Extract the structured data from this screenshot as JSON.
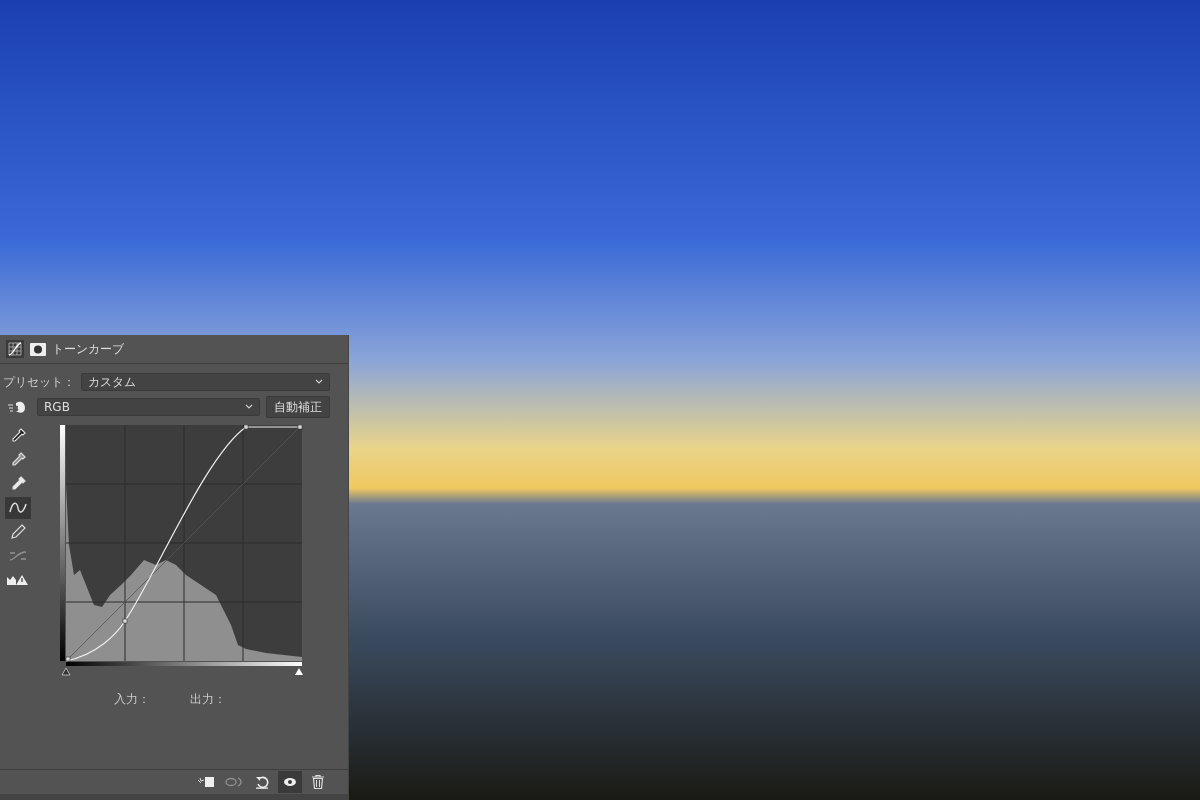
{
  "panel": {
    "title": "トーンカーブ",
    "preset_label": "プリセット：",
    "preset_value": "カスタム",
    "channel_value": "RGB",
    "auto_button": "自動補正",
    "tools": [
      {
        "kind": "eyedropper-black",
        "selected": false,
        "disabled": false
      },
      {
        "kind": "eyedropper-gray",
        "selected": false,
        "disabled": false
      },
      {
        "kind": "eyedropper-white",
        "selected": false,
        "disabled": false
      },
      {
        "kind": "curve",
        "selected": true,
        "disabled": false
      },
      {
        "kind": "pencil",
        "selected": false,
        "disabled": false
      },
      {
        "kind": "smooth",
        "selected": false,
        "disabled": true
      },
      {
        "kind": "clipping",
        "selected": false,
        "disabled": false
      }
    ],
    "input_label": "入力：",
    "output_label": "出力：",
    "footer_buttons": [
      {
        "kind": "clip",
        "selected": false,
        "disabled": false
      },
      {
        "kind": "previous",
        "selected": false,
        "disabled": true
      },
      {
        "kind": "reset",
        "selected": false,
        "disabled": false
      },
      {
        "kind": "visibility",
        "selected": true,
        "disabled": false
      },
      {
        "kind": "delete",
        "selected": false,
        "disabled": false
      }
    ]
  }
}
